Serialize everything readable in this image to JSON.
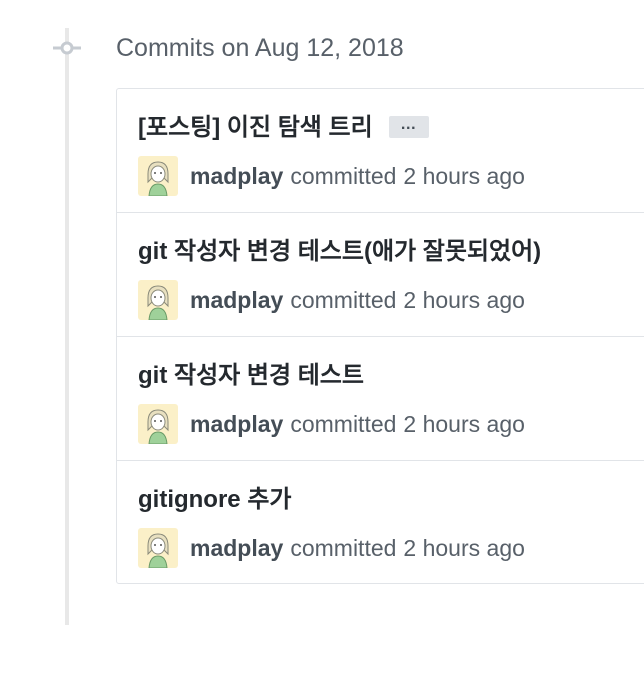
{
  "timeline": {
    "group_title": "Commits on Aug 12, 2018"
  },
  "commits": [
    {
      "title": "[포스팅] 이진 탐색 트리",
      "has_ellipsis": true,
      "ellipsis_label": "…",
      "author": "madplay",
      "action": "committed",
      "time": "2 hours ago"
    },
    {
      "title": "git 작성자 변경 테스트(애가 잘못되었어)",
      "has_ellipsis": false,
      "author": "madplay",
      "action": "committed",
      "time": "2 hours ago"
    },
    {
      "title": "git 작성자 변경 테스트",
      "has_ellipsis": false,
      "author": "madplay",
      "action": "committed",
      "time": "2 hours ago"
    },
    {
      "title": "gitignore 추가",
      "has_ellipsis": false,
      "author": "madplay",
      "action": "committed",
      "time": "2 hours ago"
    }
  ],
  "icons": {
    "timeline_node": "git-commit-icon",
    "avatar": "user-avatar"
  },
  "colors": {
    "avatar_bg": "#fbf0c8",
    "border": "#e1e4e8",
    "muted_text": "#586069"
  }
}
